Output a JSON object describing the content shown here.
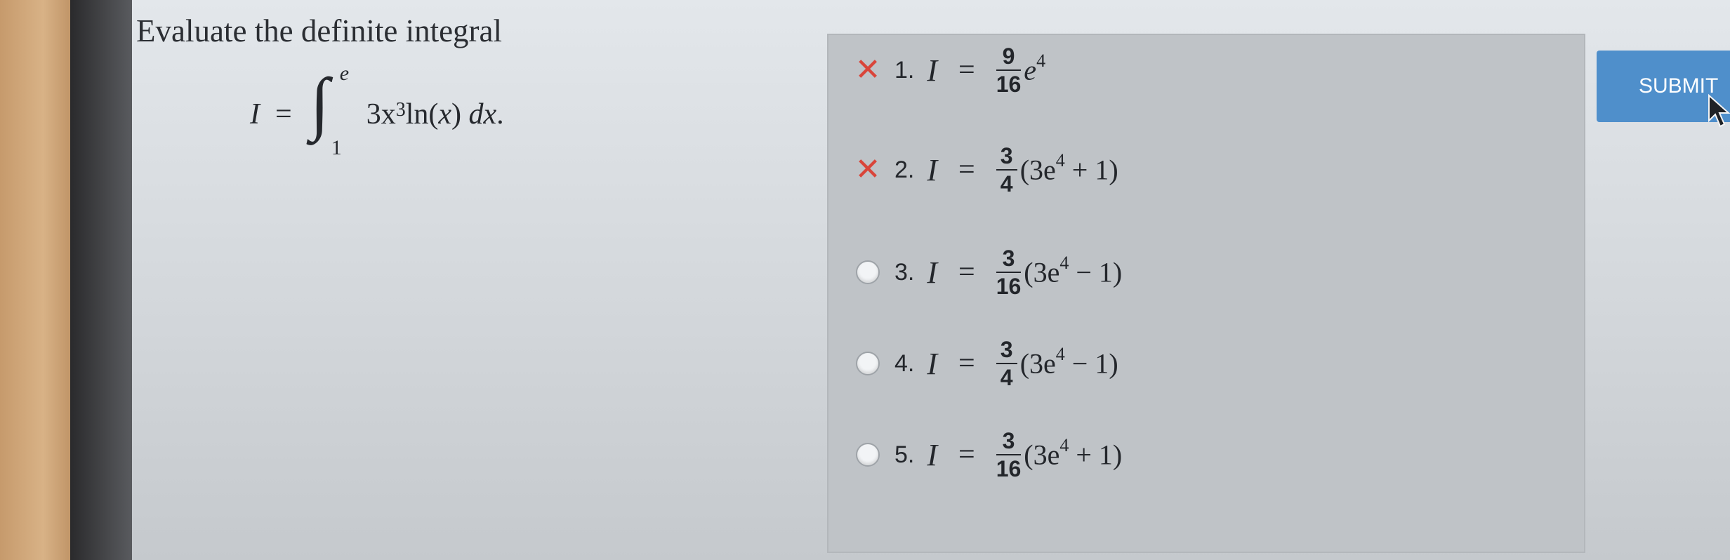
{
  "question": {
    "prompt": "Evaluate the definite integral",
    "formula": {
      "lhs": "I",
      "equals": "=",
      "upper_limit": "e",
      "lower_limit": "1",
      "integrand": "3x",
      "exponent": "3",
      "log": " ln(",
      "log_var": "x",
      "close": ") ",
      "differential": "dx",
      "period": "."
    }
  },
  "options": [
    {
      "number": "1.",
      "state": "wrong",
      "lhs": "I",
      "eq": "=",
      "numerator": "9",
      "denominator": "16",
      "expr_base": "e",
      "expr_exp": "4",
      "expr_tail": ""
    },
    {
      "number": "2.",
      "state": "wrong",
      "lhs": "I",
      "eq": "=",
      "numerator": "3",
      "denominator": "4",
      "expr_base": "(3e",
      "expr_exp": "4",
      "expr_tail": " + 1)"
    },
    {
      "number": "3.",
      "state": "unselected",
      "lhs": "I",
      "eq": "=",
      "numerator": "3",
      "denominator": "16",
      "expr_base": "(3e",
      "expr_exp": "4",
      "expr_tail": " − 1)"
    },
    {
      "number": "4.",
      "state": "unselected",
      "lhs": "I",
      "eq": "=",
      "numerator": "3",
      "denominator": "4",
      "expr_base": "(3e",
      "expr_exp": "4",
      "expr_tail": " − 1)"
    },
    {
      "number": "5.",
      "state": "unselected",
      "lhs": "I",
      "eq": "=",
      "numerator": "3",
      "denominator": "16",
      "expr_base": "(3e",
      "expr_exp": "4",
      "expr_tail": " + 1)"
    }
  ],
  "submit": {
    "label": "SUBMIT"
  },
  "icons": {
    "wrong": "x-mark-icon",
    "unselected": "radio-button-icon",
    "pointer": "mouse-cursor-icon"
  },
  "colors": {
    "submit_bg": "#4f8fcb",
    "wrong_mark": "#d9453a"
  }
}
